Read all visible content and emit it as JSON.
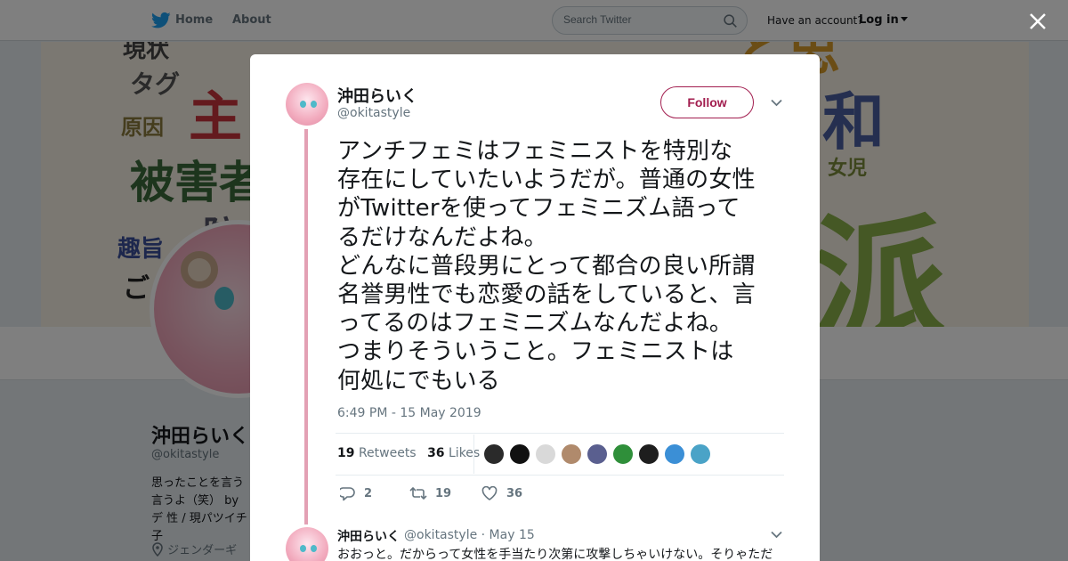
{
  "nav": {
    "home_label": "Home",
    "about_label": "About",
    "search_placeholder": "Search Twitter",
    "have_account": "Have an account?",
    "login_label": "Log in"
  },
  "banner": {
    "words": [
      "現状",
      "タグ",
      "主",
      "原因",
      "被害者",
      "防",
      "趣旨",
      "ご",
      "和",
      "派",
      "女児",
      "と思"
    ]
  },
  "profile": {
    "name": "沖田らいく",
    "handle": "@okitastyle",
    "bio": "思ったことを言う 言うよ（笑） byデ 性 / 現パツイチ子",
    "location": "ジェンダーギ"
  },
  "tweet": {
    "author_name": "沖田らいく",
    "author_handle": "@okitastyle",
    "follow_label": "Follow",
    "text": "アンチフェミはフェミニストを特別な\n存在にしていたいようだが。普通の女性\nがTwitterを使ってフェミニズム語って\nるだけなんだよね。\nどんなに普段男にとって都合の良い所謂\n名誉男性でも恋愛の話をしていると、言\nってるのはフェミニズムなんだよね。\nつまりそういうこと。フェミニストは\n何処にでもいる",
    "timestamp": "6:49 PM - 15 May 2019",
    "retweets_count": "19",
    "retweets_label": "Retweets",
    "likes_count": "36",
    "likes_label": "Likes",
    "liker_colors": [
      "#2a2a2a",
      "#111111",
      "#d9d9d9",
      "#b08a6c",
      "#5a5f8f",
      "#2f8f3a",
      "#1e1e1e",
      "#3b8fd6",
      "#4aa3c7"
    ],
    "actions": {
      "reply_count": "2",
      "retweet_count": "19",
      "like_count": "36"
    }
  },
  "reply": {
    "author_name": "沖田らいく",
    "author_handle": "@okitastyle",
    "date": "· May 15",
    "text": "おおっと。だからって女性を手当たり次第に攻撃しちゃいけない。そりゃただ"
  },
  "colors": {
    "accent": "#a21e4f",
    "thread_line": "#e3a0b4",
    "twitter_blue": "#1da1f2"
  }
}
